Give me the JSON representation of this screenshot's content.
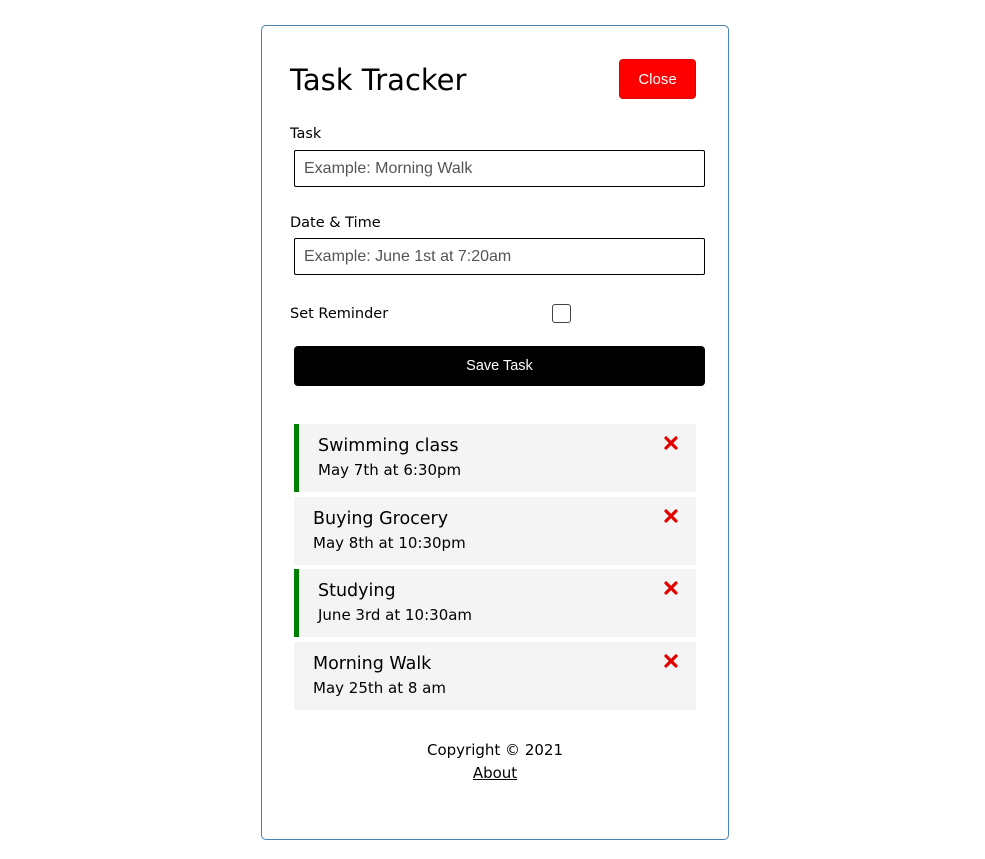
{
  "header": {
    "title": "Task Tracker",
    "close_label": "Close"
  },
  "form": {
    "task_label": "Task",
    "task_placeholder": "Example: Morning Walk",
    "datetime_label": "Date & Time",
    "datetime_placeholder": "Example: June 1st at 7:20am",
    "reminder_label": "Set Reminder",
    "reminder_checked": false,
    "save_label": "Save Task"
  },
  "tasks": [
    {
      "text": "Swimming class",
      "day": "May 7th at 6:30pm",
      "reminder": true
    },
    {
      "text": "Buying Grocery",
      "day": "May 8th at 10:30pm",
      "reminder": false
    },
    {
      "text": "Studying",
      "day": "June 3rd at 10:30am",
      "reminder": true
    },
    {
      "text": "Morning Walk",
      "day": "May 25th at 8 am",
      "reminder": false
    }
  ],
  "footer": {
    "copyright": "Copyright © 2021",
    "about_label": "About"
  },
  "colors": {
    "close_button": "#ff0000",
    "reminder_border": "#008000",
    "delete_icon": "#e00000",
    "task_background": "#f4f4f4"
  }
}
